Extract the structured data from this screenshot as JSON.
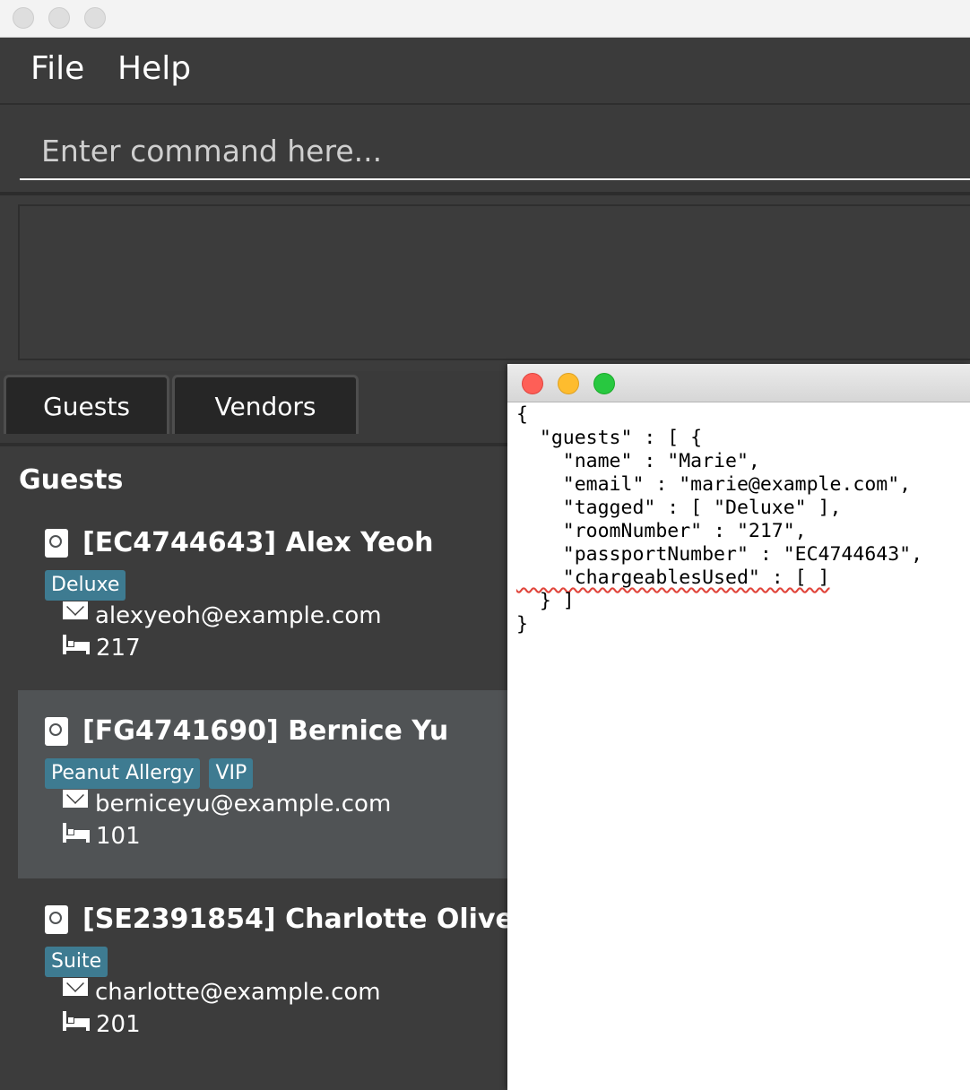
{
  "window": {
    "controls": [
      "close",
      "minimize",
      "zoom"
    ]
  },
  "menu": {
    "items": [
      "File",
      "Help"
    ]
  },
  "command": {
    "placeholder": "Enter command here...",
    "value": ""
  },
  "result_display": {
    "text": ""
  },
  "tabs": [
    {
      "label": "Guests",
      "selected": true
    },
    {
      "label": "Vendors",
      "selected": false
    }
  ],
  "panel": {
    "title": "Guests"
  },
  "guests": [
    {
      "passport": "[EC4744643]",
      "name": "Alex Yeoh",
      "tags": [
        "Deluxe"
      ],
      "email": "alexyeoh@example.com",
      "room": "217"
    },
    {
      "passport": "[FG4741690]",
      "name": "Bernice Yu",
      "tags": [
        "Peanut Allergy",
        "VIP"
      ],
      "email": "berniceyu@example.com",
      "room": "101"
    },
    {
      "passport": "[SE2391854]",
      "name": "Charlotte Oliveiro",
      "tags": [
        "Suite"
      ],
      "email": "charlotte@example.com",
      "room": "201"
    }
  ],
  "json_viewer": {
    "lines": [
      "{",
      "  \"guests\" : [ {",
      "    \"name\" : \"Marie\",",
      "    \"email\" : \"marie@example.com\",",
      "    \"tagged\" : [ \"Deluxe\" ],",
      "    \"roomNumber\" : \"217\",",
      "    \"passportNumber\" : \"EC4744643\",",
      "    \"chargeablesUsed\" : [ ]",
      "  } ]",
      "}"
    ],
    "button_colors": {
      "close": "#fe5f57",
      "minimize": "#febc2e",
      "zoom": "#28c840"
    }
  },
  "colors": {
    "tag": "#3e7b91",
    "app_background": "#3c3c3c",
    "selected_card": "#505355"
  }
}
